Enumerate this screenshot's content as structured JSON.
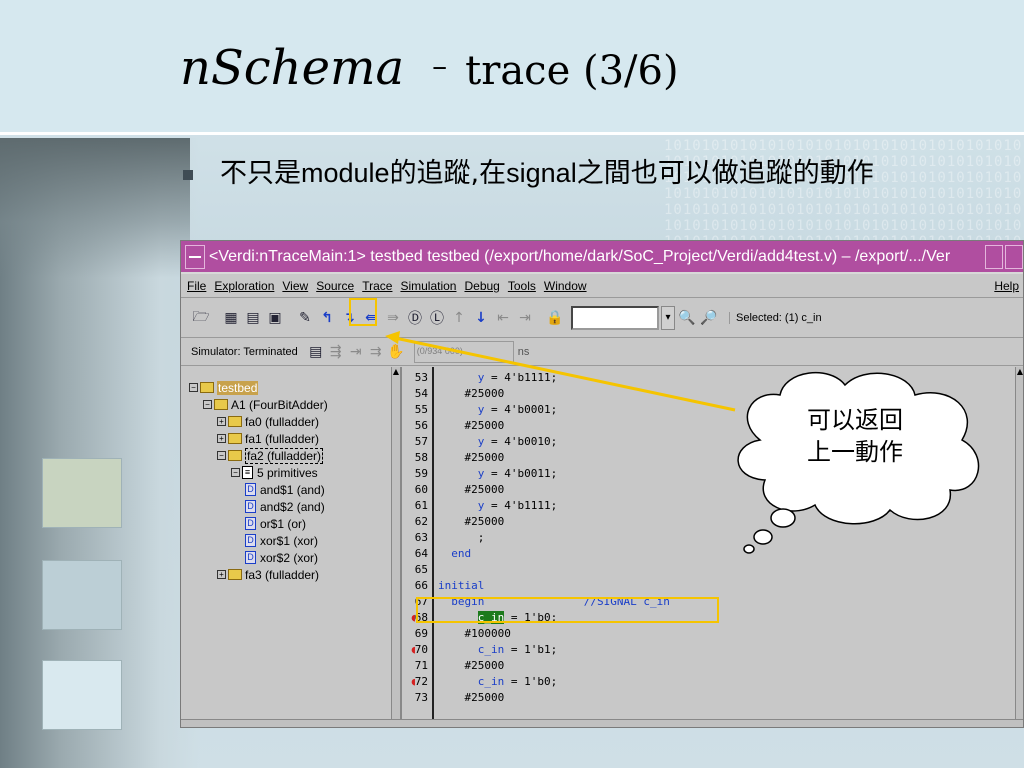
{
  "slide": {
    "title_italic": "nSchema",
    "title_dash": "–",
    "title_rest": "trace (3/6)",
    "bullet_parts": [
      "不只是",
      "module",
      "的追蹤,在",
      "signal",
      "之間也可以做追蹤的動作"
    ],
    "binary_pattern": "1010101010101010101010101010101010101010"
  },
  "window": {
    "title": "<Verdi:nTraceMain:1> testbed testbed (/export/home/dark/SoC_Project/Verdi/add4test.v) – /export/.../Ver",
    "menus": [
      "File",
      "Exploration",
      "View",
      "Source",
      "Trace",
      "Simulation",
      "Debug",
      "Tools",
      "Window"
    ],
    "help": "Help",
    "selected_label": "Selected: (1) c_in",
    "simulator_status": "Simulator: Terminated",
    "time_box": "(0/934 000)",
    "time_unit": "ns"
  },
  "tree": {
    "items": [
      {
        "label": "testbed",
        "box": "⊟"
      },
      {
        "label": "A1 (FourBitAdder)",
        "box": "⊟"
      },
      {
        "label": "fa0 (fulladder)",
        "box": "⊞"
      },
      {
        "label": "fa1 (fulladder)",
        "box": "⊞"
      },
      {
        "label": "fa2 (fulladder)",
        "box": "⊟"
      },
      {
        "label": "5 primitives",
        "box": "⊟"
      },
      {
        "label": "and$1 (and)",
        "box": ""
      },
      {
        "label": "and$2 (and)",
        "box": ""
      },
      {
        "label": "or$1 (or)",
        "box": ""
      },
      {
        "label": "xor$1 (xor)",
        "box": ""
      },
      {
        "label": "xor$2 (xor)",
        "box": ""
      },
      {
        "label": "fa3 (fulladder)",
        "box": "⊞"
      }
    ]
  },
  "code": {
    "lines": [
      {
        "num": "53",
        "text": "      y = 4'b1111;"
      },
      {
        "num": "54",
        "text": "    #25000"
      },
      {
        "num": "55",
        "text": "      y = 4'b0001;"
      },
      {
        "num": "56",
        "text": "    #25000"
      },
      {
        "num": "57",
        "text": "      y = 4'b0010;"
      },
      {
        "num": "58",
        "text": "    #25000"
      },
      {
        "num": "59",
        "text": "      y = 4'b0011;"
      },
      {
        "num": "60",
        "text": "    #25000"
      },
      {
        "num": "61",
        "text": "      y = 4'b1111;"
      },
      {
        "num": "62",
        "text": "    #25000"
      },
      {
        "num": "63",
        "text": "      ;"
      },
      {
        "num": "64",
        "text": "  end"
      },
      {
        "num": "65",
        "text": ""
      },
      {
        "num": "66",
        "text": "initial"
      },
      {
        "num": "67",
        "text": "  begin               //SIGNAL c_in"
      },
      {
        "num": "68",
        "text": "      c_in = 1'b0;"
      },
      {
        "num": "69",
        "text": "    #100000"
      },
      {
        "num": "70",
        "text": "      c_in = 1'b1;"
      },
      {
        "num": "71",
        "text": "    #25000"
      },
      {
        "num": "72",
        "text": "      c_in = 1'b0;"
      },
      {
        "num": "73",
        "text": "    #25000"
      }
    ]
  },
  "callout": {
    "line1": "可以返回",
    "line2": "上一動作"
  },
  "colors": {
    "titlebar": "#b04ea0",
    "annotation": "#f5c400",
    "keyword": "#1a3ec8",
    "signal_highlight": "#1c7a1c"
  }
}
